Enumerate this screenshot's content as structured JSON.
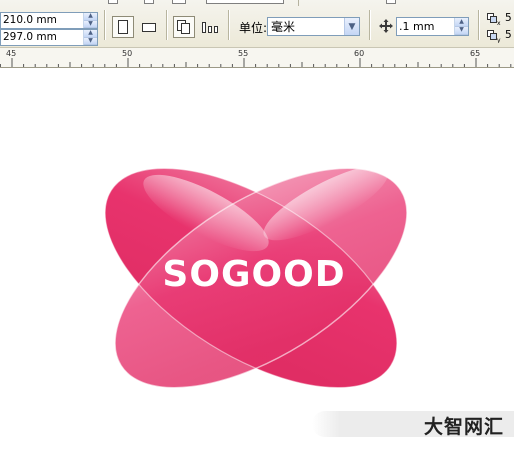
{
  "page_size": {
    "width": "210.0 mm",
    "height": "297.0 mm"
  },
  "units": {
    "label": "单位:",
    "value": "毫米"
  },
  "nudge": {
    "value": ".1 mm"
  },
  "duplicate_distance": {
    "x_value": "5",
    "y_value": "5"
  },
  "ruler": {
    "labels": [
      "45",
      "50",
      "55",
      "60",
      "65"
    ]
  },
  "canvas": {
    "logo_text": "SOGOOD",
    "logo_color": "#e8336d",
    "watermark_text": "大智网汇"
  },
  "icons": {
    "spin_up": "▲",
    "spin_down": "▼",
    "dropdown": "▼"
  }
}
